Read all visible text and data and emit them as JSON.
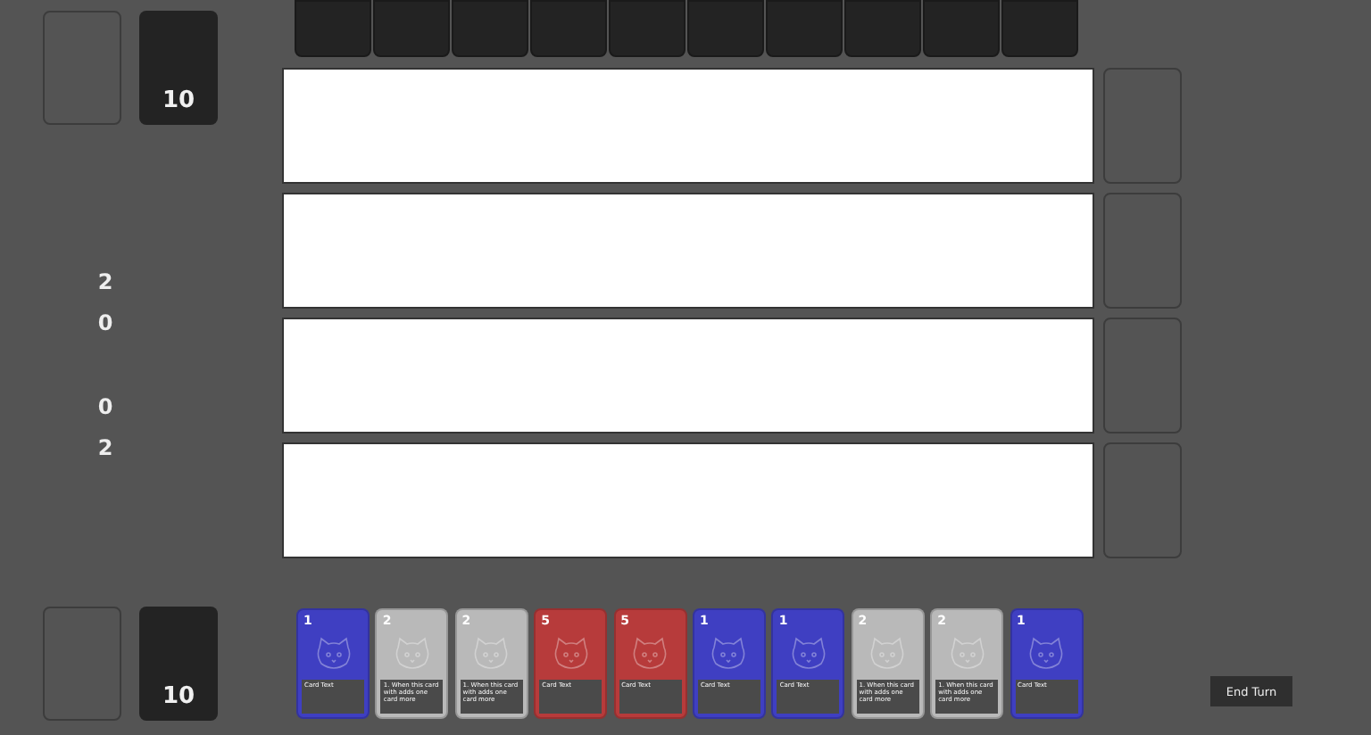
{
  "opponent": {
    "deck_count": "10",
    "hand": [
      {
        "kind": "back"
      },
      {
        "kind": "back"
      },
      {
        "kind": "back"
      },
      {
        "kind": "back"
      },
      {
        "kind": "back"
      },
      {
        "kind": "back"
      },
      {
        "kind": "back"
      },
      {
        "kind": "back"
      },
      {
        "kind": "back"
      },
      {
        "kind": "back"
      }
    ]
  },
  "scores": [
    "2",
    "0",
    "0",
    "2"
  ],
  "player": {
    "deck_count": "10"
  },
  "hand": [
    {
      "cost": "1",
      "color": "#3f3fc2",
      "text": "Card Text"
    },
    {
      "cost": "2",
      "color": "#b9b9b9",
      "text": "1. When this card with adds one card more"
    },
    {
      "cost": "2",
      "color": "#b9b9b9",
      "text": "1. When this card with adds one card more"
    },
    {
      "cost": "5",
      "color": "#b73b3b",
      "text": "Card Text"
    },
    {
      "cost": "5",
      "color": "#b73b3b",
      "text": "Card Text"
    },
    {
      "cost": "1",
      "color": "#3f3fc2",
      "text": "Card Text"
    },
    {
      "cost": "1",
      "color": "#3f3fc2",
      "text": "Card Text"
    },
    {
      "cost": "2",
      "color": "#b9b9b9",
      "text": "1. When this card with adds one card more"
    },
    {
      "cost": "2",
      "color": "#b9b9b9",
      "text": "1. When this card with adds one card more"
    },
    {
      "cost": "1",
      "color": "#3f3fc2",
      "text": "Card Text"
    }
  ],
  "end_turn_button": "End Turn"
}
